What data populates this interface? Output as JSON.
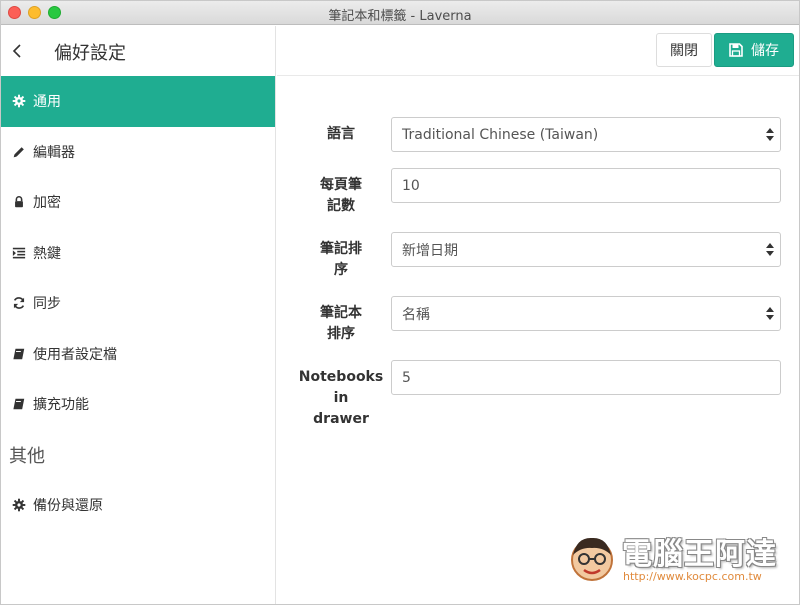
{
  "window": {
    "title": "筆記本和標籤 - Laverna"
  },
  "sidebar": {
    "title": "偏好設定",
    "items": [
      {
        "label": "通用",
        "icon": "gear-icon",
        "active": true
      },
      {
        "label": "編輯器",
        "icon": "pencil-icon",
        "active": false
      },
      {
        "label": "加密",
        "icon": "lock-icon",
        "active": false
      },
      {
        "label": "熱鍵",
        "icon": "indent-icon",
        "active": false
      },
      {
        "label": "同步",
        "icon": "refresh-icon",
        "active": false
      },
      {
        "label": "使用者設定檔",
        "icon": "book-icon",
        "active": false
      },
      {
        "label": "擴充功能",
        "icon": "book-icon",
        "active": false
      }
    ],
    "other_section": "其他",
    "other_items": [
      {
        "label": "備份與還原",
        "icon": "gear-icon"
      }
    ]
  },
  "toolbar": {
    "close_label": "關閉",
    "save_label": "儲存"
  },
  "form": {
    "language": {
      "label": "語言",
      "value": "Traditional Chinese (Taiwan)"
    },
    "per_page": {
      "label_line1": "每頁筆",
      "label_line2": "記數",
      "value": "10"
    },
    "note_sort": {
      "label_line1": "筆記排",
      "label_line2": "序",
      "value": "新增日期"
    },
    "notebook_sort": {
      "label_line1": "筆記本",
      "label_line2": "排序",
      "value": "名稱"
    },
    "notebooks_drawer": {
      "label_line1": "Notebooks",
      "label_line2": "in",
      "label_line3": "drawer",
      "value": "5"
    }
  },
  "watermark": {
    "text": "電腦王阿達",
    "url": "http://www.kocpc.com.tw"
  },
  "colors": {
    "accent": "#1fad91",
    "border": "#cccccc"
  }
}
